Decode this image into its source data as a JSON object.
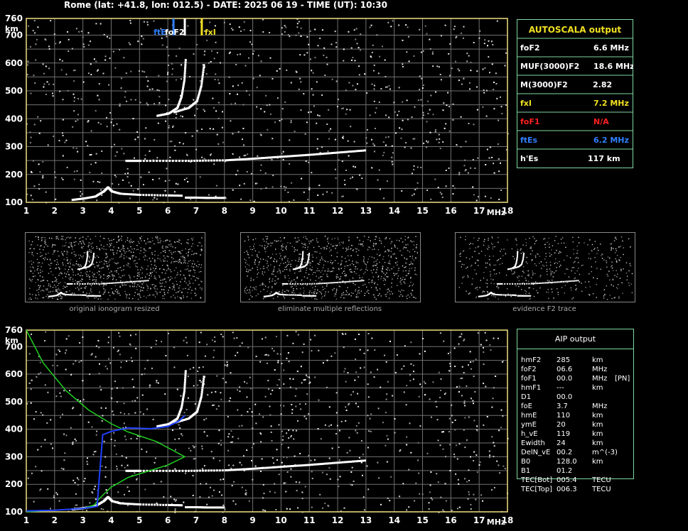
{
  "header": "Rome (lat: +41.8, lon: 012.5) - DATE: 2025 06 19 - TIME (UT): 10:30",
  "axes": {
    "y_ticks": [
      "100",
      "200",
      "300",
      "400",
      "500",
      "600",
      "700",
      "760"
    ],
    "y_unit": "km",
    "x_ticks": [
      "1",
      "2",
      "3",
      "4",
      "5",
      "6",
      "7",
      "8",
      "9",
      "10",
      "11",
      "12",
      "13",
      "14",
      "15",
      "16",
      "17",
      "18"
    ],
    "x_unit": "MHz"
  },
  "marker_labels": {
    "ftE": "ftE",
    "foF2": "foF2",
    "fxI": "fxI"
  },
  "autoscala": {
    "title": "AUTOSCALA output",
    "rows": [
      {
        "label": "foF2",
        "value": "6.6 MHz",
        "color": "#ffffff"
      },
      {
        "label": "MUF(3000)F2",
        "value": "18.6 MHz",
        "color": "#ffffff"
      },
      {
        "label": "M(3000)F2",
        "value": "2.82",
        "color": "#ffffff"
      },
      {
        "label": "fxI",
        "value": "7.2 MHz",
        "color": "#f0e020"
      },
      {
        "label": "foF1",
        "value": "N/A",
        "color": "#ff2020"
      },
      {
        "label": "ftEs",
        "value": "6.2 MHz",
        "color": "#3080ff"
      },
      {
        "label": "h'Es",
        "value": "117    km",
        "color": "#ffffff"
      }
    ]
  },
  "thumb_captions": [
    "original ionogram resized",
    "eliminate multiple reflections",
    "evidence F2 trace"
  ],
  "aip": {
    "title": "AIP output",
    "rows": [
      {
        "name": "hmF2",
        "value": "285",
        "unit": "km",
        "extra": ""
      },
      {
        "name": "foF2",
        "value": "06.6",
        "unit": "MHz",
        "extra": ""
      },
      {
        "name": "foF1",
        "value": "00.0",
        "unit": "MHz",
        "extra": "[PN]"
      },
      {
        "name": "hmF1",
        "value": "---",
        "unit": "km",
        "extra": ""
      },
      {
        "name": "D1",
        "value": "00.0",
        "unit": "",
        "extra": ""
      },
      {
        "name": "foE",
        "value": "3.7",
        "unit": "MHz",
        "extra": ""
      },
      {
        "name": "hmE",
        "value": "110",
        "unit": "km",
        "extra": ""
      },
      {
        "name": "ymE",
        "value": "20",
        "unit": "km",
        "extra": ""
      },
      {
        "name": "h_vE",
        "value": "119",
        "unit": "km",
        "extra": ""
      },
      {
        "name": "Ewidth",
        "value": "24",
        "unit": "km",
        "extra": ""
      },
      {
        "name": "DelN_vE",
        "value": "00.2",
        "unit": "m^(-3)",
        "extra": ""
      },
      {
        "name": "B0",
        "value": "128.0",
        "unit": "km",
        "extra": ""
      },
      {
        "name": "B1",
        "value": "01.2",
        "unit": "",
        "extra": ""
      },
      {
        "name": "TEC[Bot]",
        "value": "005.4",
        "unit": "TECU",
        "extra": ""
      },
      {
        "name": "TEC[Top]",
        "value": "006.3",
        "unit": "TECU",
        "extra": ""
      }
    ]
  },
  "chart_data": [
    {
      "type": "scatter",
      "panel": "autoscala-ionogram",
      "xlim": [
        1,
        18
      ],
      "ylim": [
        100,
        760
      ],
      "grid": true,
      "series": [
        {
          "name": "E trace",
          "points": [
            [
              2.6,
              110
            ],
            [
              3.0,
              115
            ],
            [
              3.4,
              122
            ],
            [
              3.7,
              140
            ],
            [
              3.85,
              155
            ],
            [
              4.0,
              140
            ],
            [
              4.3,
              132
            ],
            [
              5.0,
              128
            ],
            [
              6.0,
              126
            ],
            [
              6.5,
              125
            ]
          ]
        },
        {
          "name": "Es trace",
          "points": [
            [
              6.6,
              118
            ],
            [
              7.0,
              118
            ],
            [
              7.4,
              117
            ],
            [
              8.0,
              117
            ]
          ]
        },
        {
          "name": "F1 trace",
          "points": [
            [
              4.5,
              250
            ],
            [
              5.0,
              250
            ],
            [
              6.6,
              250
            ],
            [
              8.0,
              252
            ],
            [
              9.0,
              258
            ],
            [
              10.0,
              265
            ],
            [
              11.0,
              272
            ],
            [
              12.0,
              280
            ],
            [
              13.0,
              288
            ]
          ]
        },
        {
          "name": "F2 ordinary",
          "points": [
            [
              5.6,
              412
            ],
            [
              6.0,
              420
            ],
            [
              6.3,
              440
            ],
            [
              6.45,
              480
            ],
            [
              6.55,
              540
            ],
            [
              6.6,
              620
            ]
          ]
        },
        {
          "name": "F2 extraordinary",
          "points": [
            [
              6.2,
              425
            ],
            [
              6.7,
              440
            ],
            [
              7.0,
              465
            ],
            [
              7.15,
              520
            ],
            [
              7.25,
              600
            ]
          ]
        }
      ],
      "markers": [
        {
          "label": "ftE",
          "x": 6.2,
          "color": "#3080ff"
        },
        {
          "label": "foF2",
          "x": 6.6,
          "color": "#ffffff"
        },
        {
          "label": "fxI",
          "x": 7.2,
          "color": "#f0e020"
        }
      ]
    },
    {
      "type": "line",
      "panel": "aip-ionogram",
      "xlim": [
        1,
        18
      ],
      "ylim": [
        100,
        760
      ],
      "grid": true,
      "series": [
        {
          "name": "electron density profile",
          "color": "#20d020",
          "points": [
            [
              1.0,
              760
            ],
            [
              1.6,
              640
            ],
            [
              2.4,
              540
            ],
            [
              3.2,
              470
            ],
            [
              4.0,
              420
            ],
            [
              4.6,
              390
            ],
            [
              5.6,
              355
            ],
            [
              6.6,
              300
            ],
            [
              6.0,
              270
            ],
            [
              4.6,
              225
            ],
            [
              4.0,
              190
            ],
            [
              3.6,
              150
            ],
            [
              3.4,
              125
            ],
            [
              3.0,
              112
            ],
            [
              1.0,
              100
            ]
          ]
        },
        {
          "name": "true height profile",
          "color": "#2040ff",
          "points": [
            [
              1.0,
              103
            ],
            [
              2.0,
              106
            ],
            [
              3.0,
              112
            ],
            [
              3.5,
              120
            ],
            [
              3.7,
              380
            ],
            [
              4.0,
              392
            ],
            [
              4.6,
              405
            ],
            [
              5.4,
              402
            ],
            [
              6.0,
              410
            ],
            [
              6.4,
              430
            ],
            [
              6.6,
              450
            ]
          ]
        }
      ]
    }
  ]
}
